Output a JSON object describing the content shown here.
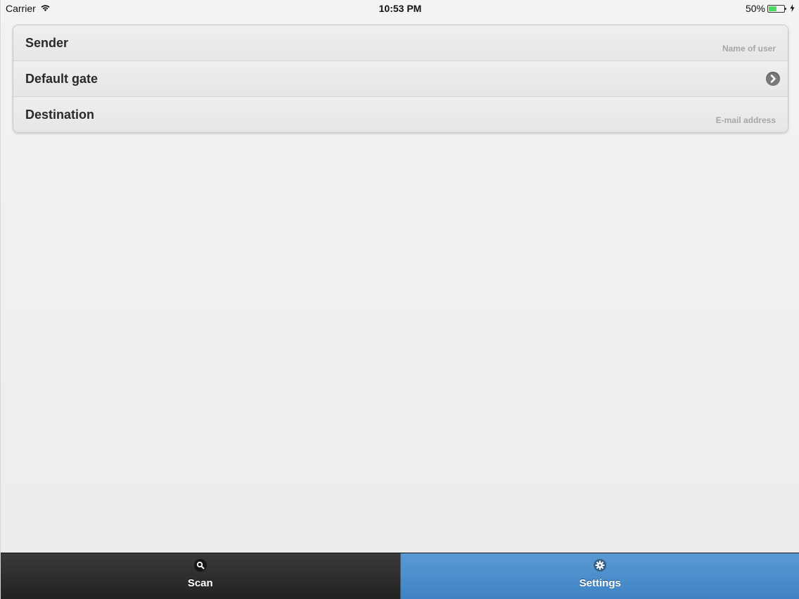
{
  "status_bar": {
    "carrier": "Carrier",
    "time": "10:53 PM",
    "battery_percent": "50%",
    "battery_level": 0.5,
    "icons": [
      "wifi-icon",
      "battery-icon",
      "charging-bolt-icon"
    ]
  },
  "settings": {
    "rows": [
      {
        "label": "Sender",
        "placeholder": "Name of user",
        "value": ""
      },
      {
        "label": "Default gate",
        "accessory": "chevron-right-icon"
      },
      {
        "label": "Destination",
        "placeholder": "E-mail address",
        "value": ""
      }
    ]
  },
  "tab_bar": {
    "tabs": [
      {
        "label": "Scan",
        "icon": "search-icon",
        "selected": false
      },
      {
        "label": "Settings",
        "icon": "gear-icon",
        "selected": true
      }
    ],
    "selected_color": "#4a8fcd"
  }
}
